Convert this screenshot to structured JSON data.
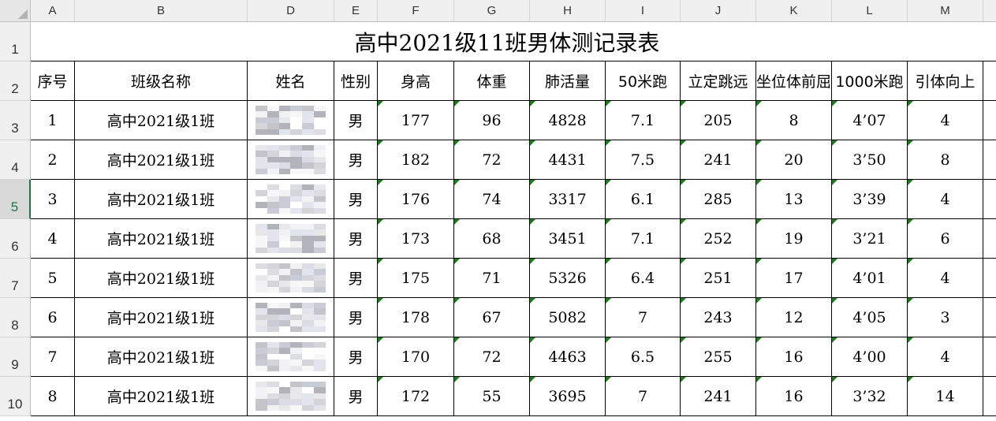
{
  "columns": [
    "A",
    "B",
    "D",
    "E",
    "F",
    "G",
    "H",
    "I",
    "J",
    "K",
    "L",
    "M"
  ],
  "row_numbers": [
    "1",
    "2",
    "3",
    "4",
    "5",
    "6",
    "7",
    "8",
    "9",
    "10"
  ],
  "selected_row_index": 4,
  "title": "高中2021级11班男体测记录表",
  "headers": [
    "序号",
    "班级名称",
    "姓名",
    "性别",
    "身高",
    "体重",
    "肺活量",
    "50米跑",
    "立定跳远",
    "坐位体前屈",
    "1000米跑",
    "引体向上"
  ],
  "rows": [
    [
      "1",
      "高中2021级1班",
      "",
      "男",
      "177",
      "96",
      "4828",
      "7.1",
      "205",
      "8",
      "4’07",
      "4"
    ],
    [
      "2",
      "高中2021级1班",
      "",
      "男",
      "182",
      "72",
      "4431",
      "7.5",
      "241",
      "20",
      "3’50",
      "8"
    ],
    [
      "3",
      "高中2021级1班",
      "",
      "男",
      "176",
      "74",
      "3317",
      "6.1",
      "285",
      "13",
      "3’39",
      "4"
    ],
    [
      "4",
      "高中2021级1班",
      "",
      "男",
      "173",
      "68",
      "3451",
      "7.1",
      "252",
      "19",
      "3’21",
      "6"
    ],
    [
      "5",
      "高中2021级1班",
      "",
      "男",
      "175",
      "71",
      "5326",
      "6.4",
      "251",
      "17",
      "4’01",
      "4"
    ],
    [
      "6",
      "高中2021级1班",
      "",
      "男",
      "178",
      "67",
      "5082",
      "7",
      "243",
      "12",
      "4’05",
      "3"
    ],
    [
      "7",
      "高中2021级1班",
      "",
      "男",
      "170",
      "72",
      "4463",
      "6.5",
      "255",
      "16",
      "4’00",
      "4"
    ],
    [
      "8",
      "高中2021级1班",
      "",
      "男",
      "172",
      "55",
      "3695",
      "7",
      "241",
      "16",
      "3’32",
      "14"
    ]
  ],
  "colors": {
    "grid_line": "#000000",
    "header_bg": "#f0f0f0",
    "selection": "#217346",
    "comment_flag": "#1e7b1e"
  }
}
